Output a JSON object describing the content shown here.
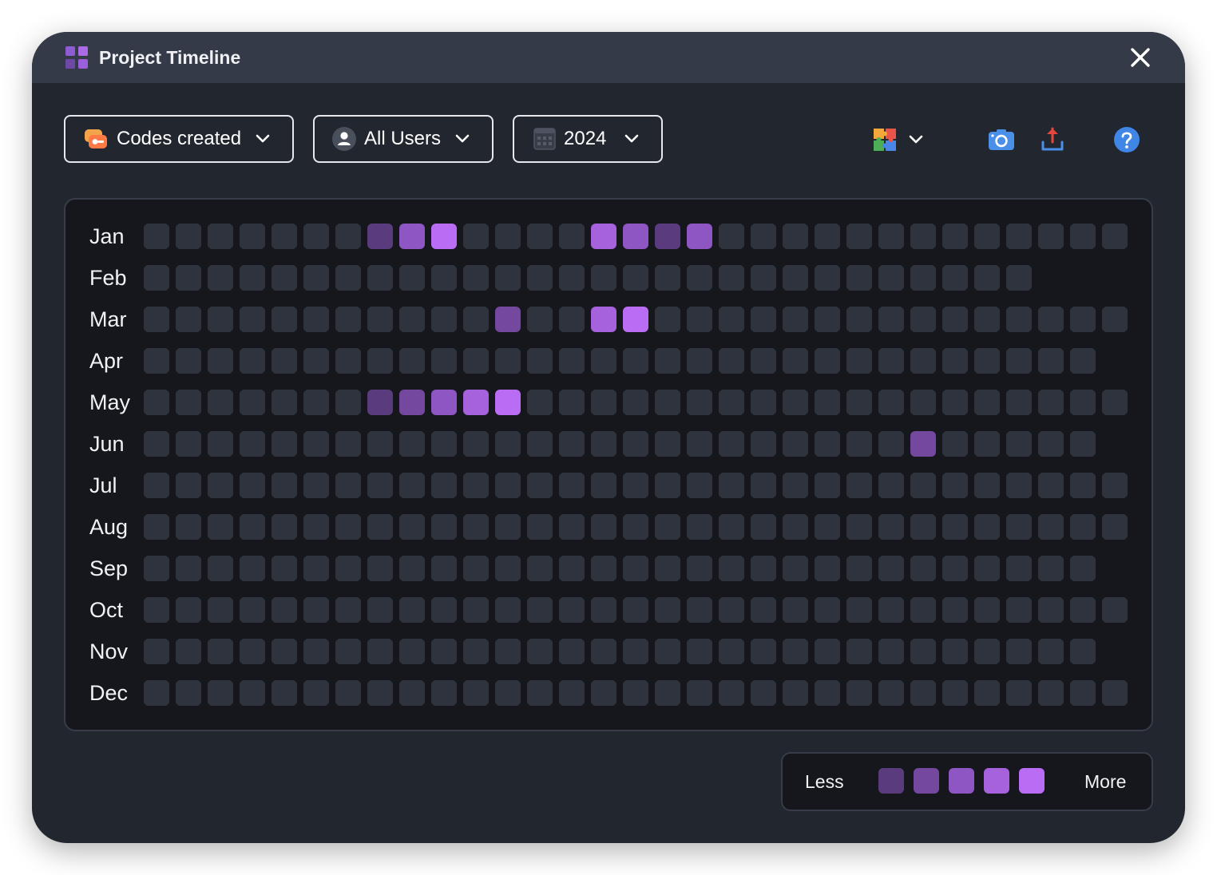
{
  "window": {
    "title": "Project Timeline",
    "close_icon": "close-icon",
    "logo_icon": "grid-logo-icon"
  },
  "filters": {
    "type": {
      "label": "Codes created",
      "icon": "code-tag-icon"
    },
    "users": {
      "label": "All Users",
      "icon": "user-icon"
    },
    "year": {
      "label": "2024",
      "icon": "calendar-icon"
    }
  },
  "toolbar": {
    "plugins_icon": "puzzle-icon",
    "screenshot_icon": "camera-icon",
    "export_icon": "upload-icon",
    "help_icon": "help-icon"
  },
  "colors": {
    "empty": "#2e333e",
    "levels": [
      "#5a3b7e",
      "#74489f",
      "#8e56c3",
      "#a562dc",
      "#bb6cf4"
    ]
  },
  "heatmap": {
    "months": [
      {
        "label": "Jan",
        "days": 31,
        "activity": {
          "8": 1,
          "9": 3,
          "10": 5,
          "15": 4,
          "16": 3,
          "17": 1,
          "18": 3
        }
      },
      {
        "label": "Feb",
        "days": 28,
        "activity": {}
      },
      {
        "label": "Mar",
        "days": 31,
        "activity": {
          "12": 2,
          "15": 4,
          "16": 5
        }
      },
      {
        "label": "Apr",
        "days": 30,
        "activity": {}
      },
      {
        "label": "May",
        "days": 31,
        "activity": {
          "8": 1,
          "9": 2,
          "10": 3,
          "11": 4,
          "12": 5
        }
      },
      {
        "label": "Jun",
        "days": 30,
        "activity": {
          "25": 2
        }
      },
      {
        "label": "Jul",
        "days": 31,
        "activity": {}
      },
      {
        "label": "Aug",
        "days": 31,
        "activity": {}
      },
      {
        "label": "Sep",
        "days": 30,
        "activity": {}
      },
      {
        "label": "Oct",
        "days": 31,
        "activity": {}
      },
      {
        "label": "Nov",
        "days": 30,
        "activity": {}
      },
      {
        "label": "Dec",
        "days": 31,
        "activity": {}
      }
    ]
  },
  "legend": {
    "less": "Less",
    "more": "More"
  }
}
